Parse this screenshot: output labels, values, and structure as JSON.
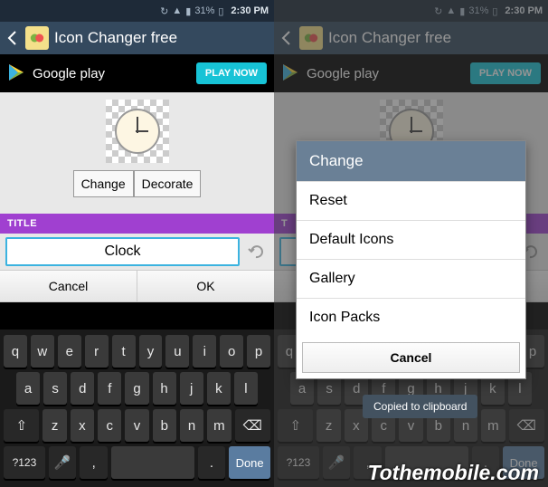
{
  "statusbar": {
    "battery": "31%",
    "time": "2:30 PM"
  },
  "titlebar": {
    "title": "Icon Changer free"
  },
  "ad": {
    "brand": "Google play",
    "cta": "PLAY NOW"
  },
  "buttons": {
    "change": "Change",
    "decorate": "Decorate"
  },
  "section": {
    "title_label": "TITLE",
    "title_label_short": "T"
  },
  "input": {
    "value": "Clock"
  },
  "dlg": {
    "cancel": "Cancel",
    "ok": "OK"
  },
  "keyboard": {
    "row1": [
      "q",
      "w",
      "e",
      "r",
      "t",
      "y",
      "u",
      "i",
      "o",
      "p"
    ],
    "row2": [
      "a",
      "s",
      "d",
      "f",
      "g",
      "h",
      "j",
      "k",
      "l"
    ],
    "row3": [
      "z",
      "x",
      "c",
      "v",
      "b",
      "n",
      "m"
    ],
    "shift": "⇧",
    "backspace": "⌫",
    "sym": "?123",
    "mic": "🎤",
    "comma": ",",
    "period": ".",
    "done": "Done"
  },
  "popup": {
    "title": "Change",
    "items": [
      "Reset",
      "Default Icons",
      "Gallery",
      "Icon Packs"
    ],
    "cancel": "Cancel"
  },
  "toast": "Copied to clipboard",
  "watermark": "Tothemobile.com"
}
